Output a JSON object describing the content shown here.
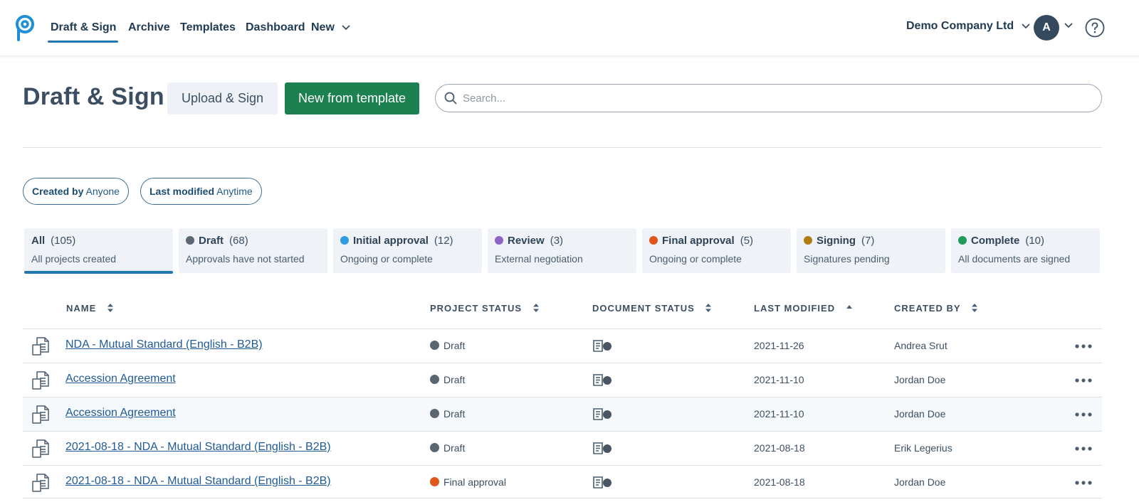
{
  "nav": {
    "logo_icon": "app-logo-icon",
    "items": [
      "Draft & Sign",
      "Archive",
      "Templates",
      "Dashboard"
    ],
    "new_label": "New",
    "active_item": "Draft & Sign",
    "company": "Demo Company Ltd",
    "avatar_initial": "A",
    "help_icon": "help-circle-icon"
  },
  "header": {
    "title": "Draft & Sign",
    "upload_label": "Upload & Sign",
    "template_label": "New from template",
    "search_placeholder": "Search..."
  },
  "filters": [
    {
      "label": "Created by",
      "value": "Anyone"
    },
    {
      "label": "Last modified",
      "value": "Anytime"
    }
  ],
  "status_tabs": [
    {
      "label": "All",
      "count": "(105)",
      "sub": "All projects created",
      "color": null,
      "active": true
    },
    {
      "label": "Draft",
      "count": "(68)",
      "sub": "Approvals have not started",
      "color": "#5b6670"
    },
    {
      "label": "Initial approval",
      "count": "(12)",
      "sub": "Ongoing or complete",
      "color": "#2d9be0"
    },
    {
      "label": "Review",
      "count": "(3)",
      "sub": "External negotiation",
      "color": "#8e63c8"
    },
    {
      "label": "Final approval",
      "count": "(5)",
      "sub": "Ongoing or complete",
      "color": "#e0561c"
    },
    {
      "label": "Signing",
      "count": "(7)",
      "sub": "Signatures pending",
      "color": "#b07d10"
    },
    {
      "label": "Complete",
      "count": "(10)",
      "sub": "All documents are signed",
      "color": "#1d9a5c"
    }
  ],
  "table": {
    "columns": [
      "NAME",
      "PROJECT STATUS",
      "DOCUMENT STATUS",
      "LAST MODIFIED",
      "CREATED BY"
    ],
    "sort_column": "LAST MODIFIED",
    "sort_direction": "ascending",
    "rows": [
      {
        "name": "NDA - Mutual Standard (English - B2B)",
        "status": "Draft",
        "status_color": "#5b6670",
        "modified": "2021-11-26",
        "created_by": "Andrea Srut"
      },
      {
        "name": "Accession Agreement",
        "status": "Draft",
        "status_color": "#5b6670",
        "modified": "2021-11-10",
        "created_by": "Jordan Doe"
      },
      {
        "name": "Accession Agreement",
        "status": "Draft",
        "status_color": "#5b6670",
        "modified": "2021-11-10",
        "created_by": "Jordan Doe"
      },
      {
        "name": "2021-08-18 - NDA - Mutual Standard (English - B2B)",
        "status": "Draft",
        "status_color": "#5b6670",
        "modified": "2021-08-18",
        "created_by": "Erik Legerius"
      },
      {
        "name": "2021-08-18 - NDA - Mutual Standard (English - B2B)",
        "status": "Final approval",
        "status_color": "#e0561c",
        "modified": "2021-08-18",
        "created_by": "Jordan Doe"
      }
    ]
  }
}
